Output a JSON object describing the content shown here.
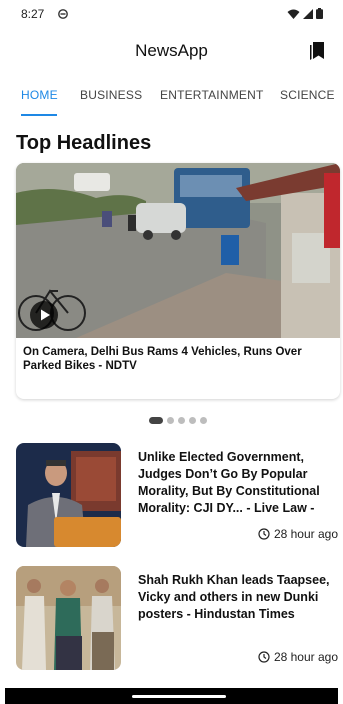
{
  "status": {
    "time": "8:27"
  },
  "app": {
    "title": "NewsApp"
  },
  "tabs": [
    "HOME",
    "BUSINESS",
    "ENTERTAINMENT",
    "SCIENCE"
  ],
  "section_title": "Top Headlines",
  "hero": {
    "caption": "On Camera, Delhi Bus Rams 4 Vehicles, Runs Over Parked Bikes - NDTV"
  },
  "carousel": {
    "count": 5,
    "active_index": 0
  },
  "news": [
    {
      "title": "Unlike Elected Government, Judges Don’t Go By Popular Morality, But By Constitutional Morality: CJI DY... - Live Law -",
      "time": "28 hour ago"
    },
    {
      "title": "Shah Rukh Khan leads Taapsee, Vicky and others in new Dunki posters - Hindustan Times",
      "time": "28 hour ago"
    }
  ],
  "colors": {
    "accent": "#1e88e5",
    "background": "#ffffff"
  }
}
